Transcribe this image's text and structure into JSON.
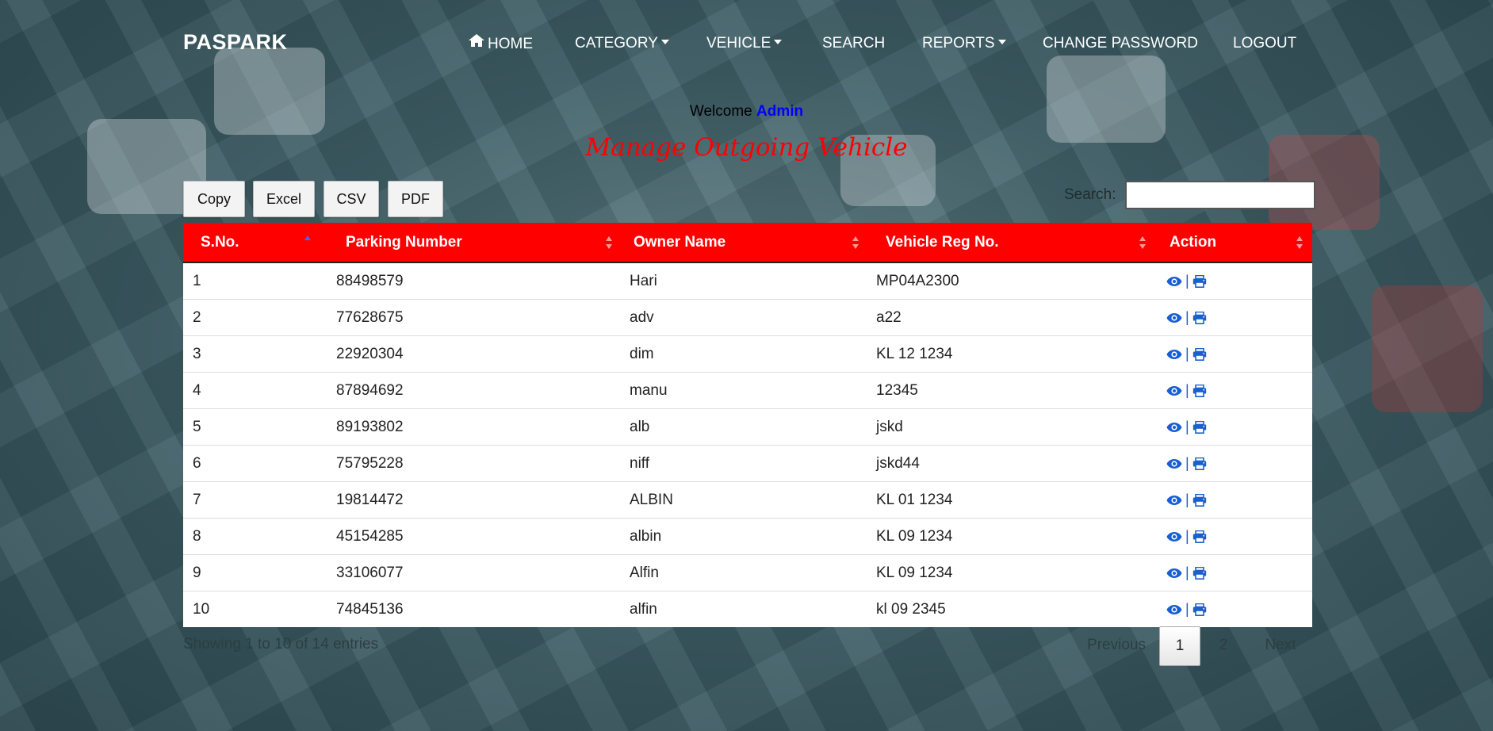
{
  "nav": {
    "brand": "PASPARK",
    "items": [
      {
        "label": "HOME"
      },
      {
        "label": "CATEGORY"
      },
      {
        "label": "VEHICLE"
      },
      {
        "label": "SEARCH"
      },
      {
        "label": "REPORTS"
      },
      {
        "label": "CHANGE PASSWORD"
      },
      {
        "label": "LOGOUT"
      }
    ]
  },
  "welcome": {
    "prefix": "Welcome",
    "user": "Admin"
  },
  "page_title": "Manage Outgoing Vehicle",
  "buttons": {
    "copy": "Copy",
    "excel": "Excel",
    "csv": "CSV",
    "pdf": "PDF"
  },
  "search": {
    "label": "Search:",
    "value": ""
  },
  "table": {
    "headers": [
      "S.No.",
      "Parking Number",
      "Owner Name",
      "Vehicle Reg No.",
      "Action"
    ],
    "rows": [
      [
        "1",
        "88498579",
        "Hari",
        "MP04A2300"
      ],
      [
        "2",
        "77628675",
        "adv",
        "a22"
      ],
      [
        "3",
        "22920304",
        "dim",
        "KL 12 1234"
      ],
      [
        "4",
        "87894692",
        "manu",
        "12345"
      ],
      [
        "5",
        "89193802",
        "alb",
        "jskd"
      ],
      [
        "6",
        "75795228",
        "niff",
        "jskd44"
      ],
      [
        "7",
        "19814472",
        "ALBIN",
        "KL 01 1234"
      ],
      [
        "8",
        "45154285",
        "albin",
        "KL 09 1234"
      ],
      [
        "9",
        "33106077",
        "Alfin",
        "KL 09 1234"
      ],
      [
        "10",
        "74845136",
        "alfin",
        "kl 09 2345"
      ]
    ],
    "action_separator": "|",
    "action_icons": [
      "eye-icon",
      "print-icon"
    ]
  },
  "footer": {
    "info": "Showing 1 to 10 of 14 entries",
    "pagination": {
      "previous": "Previous",
      "pages": [
        "1",
        "2"
      ],
      "next": "Next",
      "current": "1"
    }
  },
  "colors": {
    "header_red": "#ff0000",
    "title_red": "#ff0000",
    "link_blue": "#0000ff",
    "icon_blue": "#1a5fd1"
  }
}
